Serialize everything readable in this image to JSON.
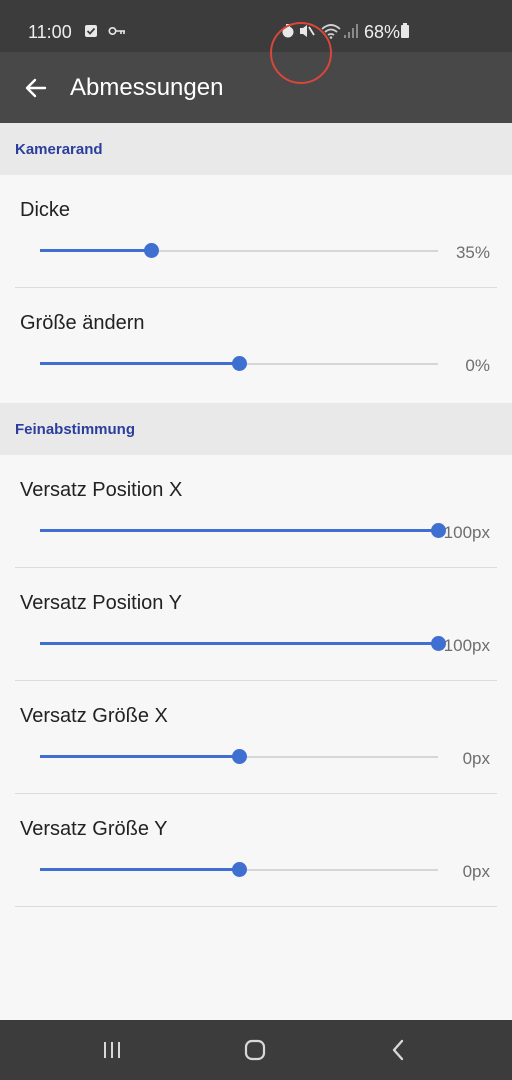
{
  "status_bar": {
    "time": "11:00",
    "battery_percent": "68%"
  },
  "app_bar": {
    "title": "Abmessungen"
  },
  "sections": [
    {
      "title": "Kamerarand",
      "items": [
        {
          "label": "Dicke",
          "value_text": "35%",
          "fraction": 0.28
        },
        {
          "label": "Größe ändern",
          "value_text": "0%",
          "fraction": 0.5
        }
      ]
    },
    {
      "title": "Feinabstimmung",
      "items": [
        {
          "label": "Versatz Position X",
          "value_text": "100px",
          "fraction": 1.0
        },
        {
          "label": "Versatz Position Y",
          "value_text": "100px",
          "fraction": 1.0
        },
        {
          "label": "Versatz Größe X",
          "value_text": "0px",
          "fraction": 0.5
        },
        {
          "label": "Versatz Größe Y",
          "value_text": "0px",
          "fraction": 0.5
        }
      ]
    }
  ],
  "colors": {
    "accent": "#3f6fd0",
    "section_title": "#2c3e9c",
    "toolbar": "#484848",
    "status_bar": "#3c3c3c"
  },
  "icons": {
    "back": "arrow-left-icon",
    "nav_recent": "recent-apps-icon",
    "nav_home": "home-icon",
    "nav_back": "nav-back-icon"
  }
}
